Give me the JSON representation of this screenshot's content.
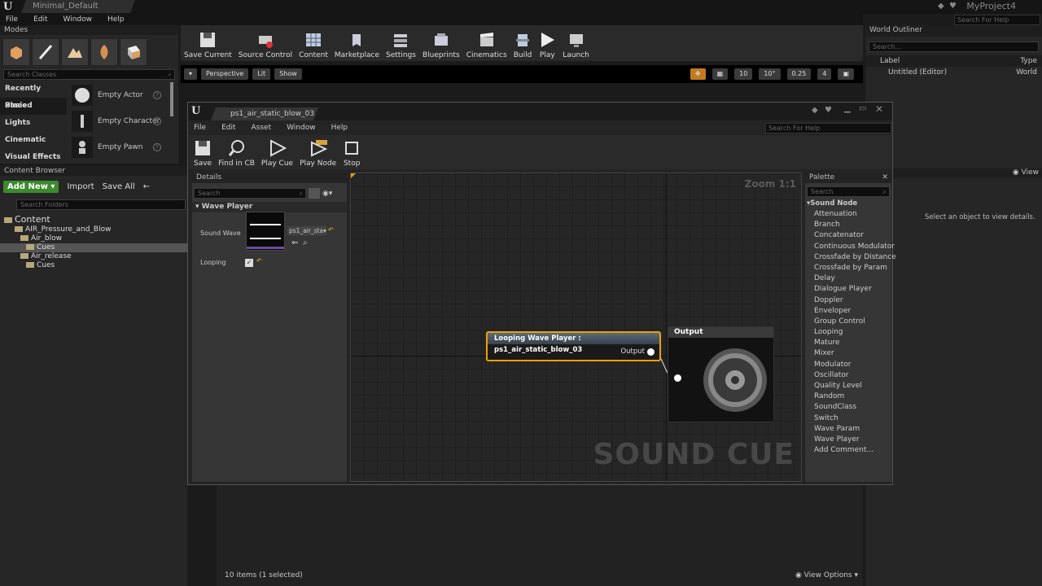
{
  "app": {
    "doc_tab": "Minimal_Default",
    "project": "MyProject4",
    "search_help_placeholder": "Search For Help",
    "menu": [
      "File",
      "Edit",
      "Window",
      "Help"
    ]
  },
  "modes": {
    "title": "Modes",
    "search_placeholder": "Search Classes",
    "categories": [
      "Recently Placed",
      "Basic",
      "Lights",
      "Cinematic",
      "Visual Effects"
    ],
    "actors": [
      "Empty Actor",
      "Empty Character",
      "Empty Pawn"
    ]
  },
  "toolbar": {
    "items": [
      "Save Current",
      "Source Control",
      "Content",
      "Marketplace",
      "Settings",
      "Blueprints",
      "Cinematics",
      "Build",
      "Play",
      "Launch"
    ]
  },
  "viewport": {
    "perspective": "Perspective",
    "lit": "Lit",
    "show": "Show",
    "grid_snap": "10",
    "rot_snap": "10°",
    "scale_snap": "0.25",
    "camera_speed": "4"
  },
  "content_browser": {
    "title": "Content Browser",
    "add_new": "Add New",
    "import": "Import",
    "save_all": "Save All",
    "search_folders": "Search Folders",
    "tree": [
      {
        "label": "Content",
        "indent": 0
      },
      {
        "label": "AIR_Pressure_and_Blow",
        "indent": 1
      },
      {
        "label": "Air_blow",
        "indent": 2
      },
      {
        "label": "Cues",
        "indent": 3
      },
      {
        "label": "Air_release",
        "indent": 2
      },
      {
        "label": "Cues",
        "indent": 3
      }
    ],
    "status": "10 items (1 selected)",
    "view_options": "View Options"
  },
  "world_outliner": {
    "title": "World Outliner",
    "search_placeholder": "Search...",
    "col_label": "Label",
    "col_type": "Type",
    "row_label": "Untitled (Editor)",
    "row_type": "World",
    "details_empty": "Select an object to view details.",
    "view": "View"
  },
  "sound_cue": {
    "tab": "ps1_air_static_blow_03_Cu",
    "menu": [
      "File",
      "Edit",
      "Asset",
      "Window",
      "Help"
    ],
    "search_help": "Search For Help",
    "toolbar": [
      "Save",
      "Find in CB",
      "Play Cue",
      "Play Node",
      "Stop"
    ],
    "details": {
      "title": "Details",
      "search": "Search",
      "section": "Wave Player",
      "sound_wave_label": "Sound Wave",
      "sound_wave_value": "ps1_air_sta",
      "looping_label": "Looping"
    },
    "graph": {
      "zoom": "Zoom 1:1",
      "wave_node_title": "Looping Wave Player : ps1_air_static_blow_03",
      "wave_node_pin": "Output",
      "output_node_title": "Output",
      "watermark": "SOUND CUE"
    },
    "palette": {
      "title": "Palette",
      "search": "Search",
      "category": "Sound Node",
      "items": [
        "Attenuation",
        "Branch",
        "Concatenator",
        "Continuous Modulator",
        "Crossfade by Distance",
        "Crossfade by Param",
        "Delay",
        "Dialogue Player",
        "Doppler",
        "Enveloper",
        "Group Control",
        "Looping",
        "Mature",
        "Mixer",
        "Modulator",
        "Oscillator",
        "Quality Level",
        "Random",
        "SoundClass",
        "Switch",
        "Wave Param",
        "Wave Player",
        "Add Comment..."
      ]
    }
  }
}
